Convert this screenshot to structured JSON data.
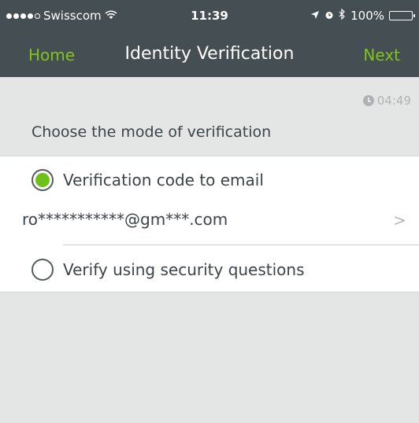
{
  "status_bar": {
    "carrier": "Swisscom",
    "time": "11:39",
    "battery": "100%"
  },
  "nav": {
    "home_label": "Home",
    "title": "Identity Verification",
    "next_label": "Next"
  },
  "timer": "04:49",
  "section_title": "Choose the mode of verification",
  "options": [
    {
      "label": "Verification code to email",
      "selected": true,
      "email_masked": "ro***********@gm***.com"
    },
    {
      "label": "Verify using security questions",
      "selected": false
    }
  ],
  "colors": {
    "nav_bg": "#454e53",
    "accent": "#7fc31c",
    "radio_selected": "#6cc21a",
    "page_bg": "#e4e5e5"
  },
  "icons": [
    "signal-dots-icon",
    "wifi-icon",
    "location-arrow-icon",
    "alarm-icon",
    "bluetooth-icon",
    "battery-icon",
    "clock-icon",
    "chevron-right-icon"
  ]
}
